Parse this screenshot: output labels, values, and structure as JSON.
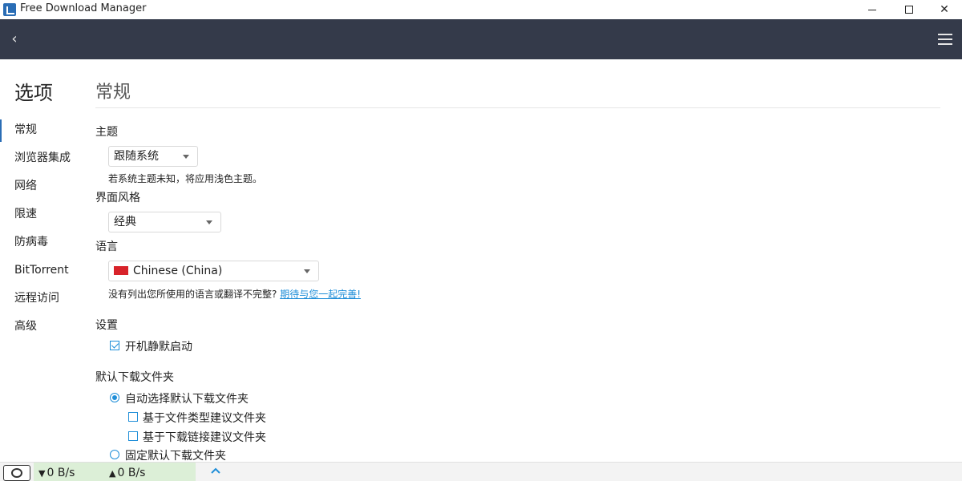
{
  "window": {
    "title": "Free Download Manager"
  },
  "sidebar": {
    "title": "选项",
    "items": [
      {
        "label": "常规",
        "active": true
      },
      {
        "label": "浏览器集成"
      },
      {
        "label": "网络"
      },
      {
        "label": "限速"
      },
      {
        "label": "防病毒"
      },
      {
        "label": "BitTorrent"
      },
      {
        "label": "远程访问"
      },
      {
        "label": "高级"
      }
    ]
  },
  "main": {
    "title": "常规",
    "theme": {
      "label": "主题",
      "value": "跟随系统",
      "hint": "若系统主题未知，将应用浅色主题。"
    },
    "style": {
      "label": "界面风格",
      "value": "经典"
    },
    "language": {
      "label": "语言",
      "value": "Chinese (China)",
      "hint": "没有列出您所使用的语言或翻译不完整?",
      "link": "期待与您一起完善!"
    },
    "settings": {
      "label": "设置",
      "silent_start": {
        "label": "开机静默启动",
        "checked": true
      }
    },
    "download_folder": {
      "label": "默认下载文件夹",
      "auto_select": {
        "label": "自动选择默认下载文件夹",
        "selected": true
      },
      "by_type": {
        "label": "基于文件类型建议文件夹",
        "checked": false
      },
      "by_link": {
        "label": "基于下载链接建议文件夹",
        "checked": false
      },
      "fixed": {
        "label": "固定默认下载文件夹",
        "selected": false
      }
    }
  },
  "statusbar": {
    "download_speed": "0 B/s",
    "upload_speed": "0 B/s"
  },
  "colors": {
    "header_bg": "#343a4a",
    "accent": "#1f8ed8",
    "speed_panel_bg": "#dcefd7"
  },
  "icons": [
    "app-logo-icon",
    "minimize-icon",
    "maximize-icon",
    "close-icon",
    "back-icon",
    "menu-icon",
    "snail-icon",
    "download-arrow-icon",
    "upload-arrow-icon",
    "chevron-up-icon"
  ]
}
